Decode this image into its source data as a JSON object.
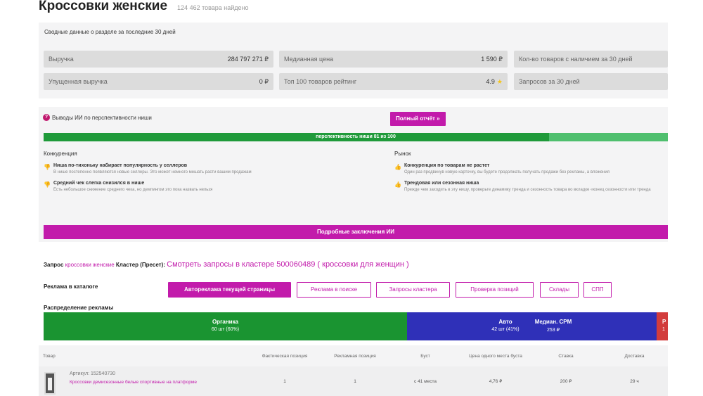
{
  "header": {
    "title": "Кроссовки женские",
    "found": "124 462 товара найдено"
  },
  "summary": {
    "caption": "Сводные данные о разделе за последние 30 дней",
    "metrics": [
      {
        "label": "Выручка",
        "value": "284 797 271 ₽"
      },
      {
        "label": "Медианная цена",
        "value": "1 590 ₽"
      },
      {
        "label": "Кол-во товаров с наличием за 30 дней",
        "value": ""
      },
      {
        "label": "Упущенная выручка",
        "value": "0 ₽"
      },
      {
        "label": "Топ 100 товаров рейтинг",
        "value": "4.9"
      },
      {
        "label": "Запросов за 30 дней",
        "value": ""
      }
    ]
  },
  "ai": {
    "header": "Выводы ИИ по перспективности ниши",
    "full_report": "Полный отчёт »",
    "progress_label": "перспективность ниши 81 из 100",
    "progress_value": 81,
    "progress_max": 100,
    "competition": {
      "title": "Конкуренция",
      "items": [
        {
          "title": "Ниша по-тихоньку набирает популярность у селлеров",
          "desc": "В нише постепенно появляются новые селлеры. Это может немного мешать расти вашим продажам",
          "icon": "thumb-down-icon"
        },
        {
          "title": "Средний чек слегка снизился в нише",
          "desc": "Есть небольшое снижение среднего чека, но демпингом это пока назвать нельзя",
          "icon": "thumb-down-icon"
        }
      ]
    },
    "market": {
      "title": "Рынок",
      "items": [
        {
          "title": "Конкуренция по товарам не растет",
          "desc": "Один раз продвинув новую карточку, вы будете продолжать получать продажи без рекламы, а вложения",
          "icon": "thumb-up-icon"
        },
        {
          "title": "Трендовая или сезонная ниша",
          "desc": "Прежде чем заходить в эту нишу, проверьте динамику тренда и сезонность товара во вкладке «конец сезонности или тренда",
          "icon": "thumb-up-icon"
        }
      ]
    },
    "conclusions_button": "Подробные заключения ИИ"
  },
  "query": {
    "label": "Запрос",
    "value": "кроссовки женские",
    "cluster_label": "Кластер (Пресет):",
    "cluster_link": "Смотреть запросы в кластере 500060489 ( кроссовки для женщин )"
  },
  "ads": {
    "catalog_label": "Реклама в каталоге",
    "buttons": [
      "Автореклама текущей страницы",
      "Реклама в поиске",
      "Запросы кластера",
      "Проверка позиций",
      "Склады",
      "СПП"
    ],
    "distribution_label": "Распределение рекламы",
    "organic": {
      "title": "Органика",
      "sub": "60 шт (60%)",
      "percent": 60
    },
    "auto": {
      "title": "Авто",
      "sub": "42 шт (41%)",
      "percent": 41
    },
    "cpm": {
      "title": "Медиан. CPM",
      "sub": "253 ₽"
    },
    "red": {
      "title": "Р",
      "sub": "1"
    },
    "colors": {
      "organic": "#1a9431",
      "auto": "#2f30b8",
      "red": "#d23c3c",
      "accent": "#c21bab"
    }
  },
  "table": {
    "columns": [
      "Товар",
      "Фактическая позиция",
      "Рекламная позиция",
      "Буст",
      "Цена одного места буста",
      "Ставка",
      "Доставка"
    ],
    "rows": [
      {
        "article": "Артикул: 152540730",
        "name": "Кроссовки демисезонные белые спортивные на платформе",
        "fact_pos": "1",
        "ad_pos": "1",
        "boost": "с 41 места",
        "boost_price": "4,76 ₽",
        "bid": "200 ₽",
        "delivery": "29 ч"
      }
    ]
  }
}
